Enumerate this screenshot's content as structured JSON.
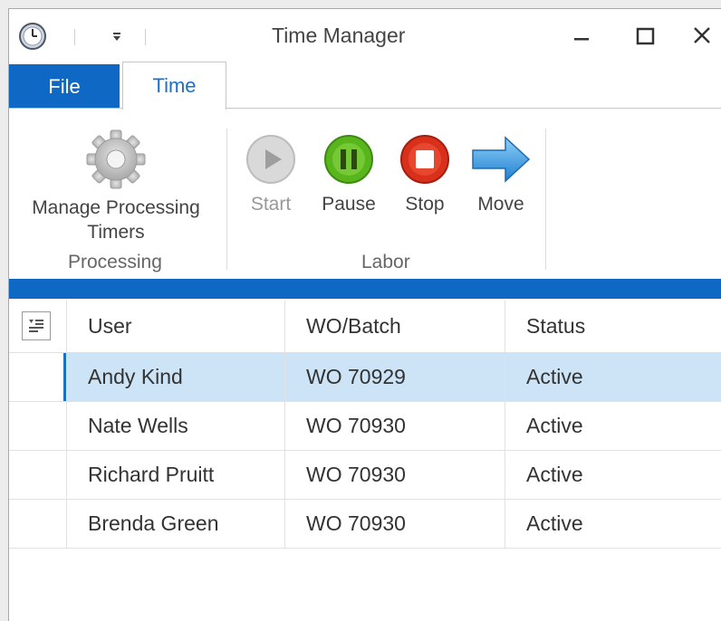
{
  "window": {
    "title": "Time Manager",
    "app_icon": "clock-icon",
    "controls": [
      "minimize-icon",
      "maximize-icon",
      "close-icon"
    ]
  },
  "tabs": [
    {
      "label": "File",
      "active": false
    },
    {
      "label": "Time",
      "active": true
    }
  ],
  "ribbon": {
    "groups": [
      {
        "label": "Processing",
        "buttons": [
          {
            "label_line1": "Manage Processing",
            "label_line2": "Timers",
            "icon": "gear-icon",
            "enabled": true
          }
        ]
      },
      {
        "label": "Labor",
        "buttons": [
          {
            "label": "Start",
            "icon": "play-icon",
            "enabled": false
          },
          {
            "label": "Pause",
            "icon": "pause-icon",
            "enabled": true
          },
          {
            "label": "Stop",
            "icon": "stop-icon",
            "enabled": true
          },
          {
            "label": "Move",
            "icon": "arrow-right-icon",
            "enabled": true
          }
        ]
      }
    ]
  },
  "grid": {
    "columns": [
      "User",
      "WO/Batch",
      "Status"
    ],
    "rows": [
      {
        "user": "Andy Kind",
        "wo": "WO 70929",
        "status": "Active",
        "selected": true
      },
      {
        "user": "Nate Wells",
        "wo": "WO 70930",
        "status": "Active",
        "selected": false
      },
      {
        "user": "Richard Pruitt",
        "wo": "WO 70930",
        "status": "Active",
        "selected": false
      },
      {
        "user": "Brenda Green",
        "wo": "WO 70930",
        "status": "Active",
        "selected": false
      }
    ]
  },
  "colors": {
    "accent": "#1068c5",
    "selected_row": "#cde4f7",
    "pause_green": "#58b51c",
    "stop_red": "#d9301c",
    "move_blue": "#2e9be0"
  }
}
